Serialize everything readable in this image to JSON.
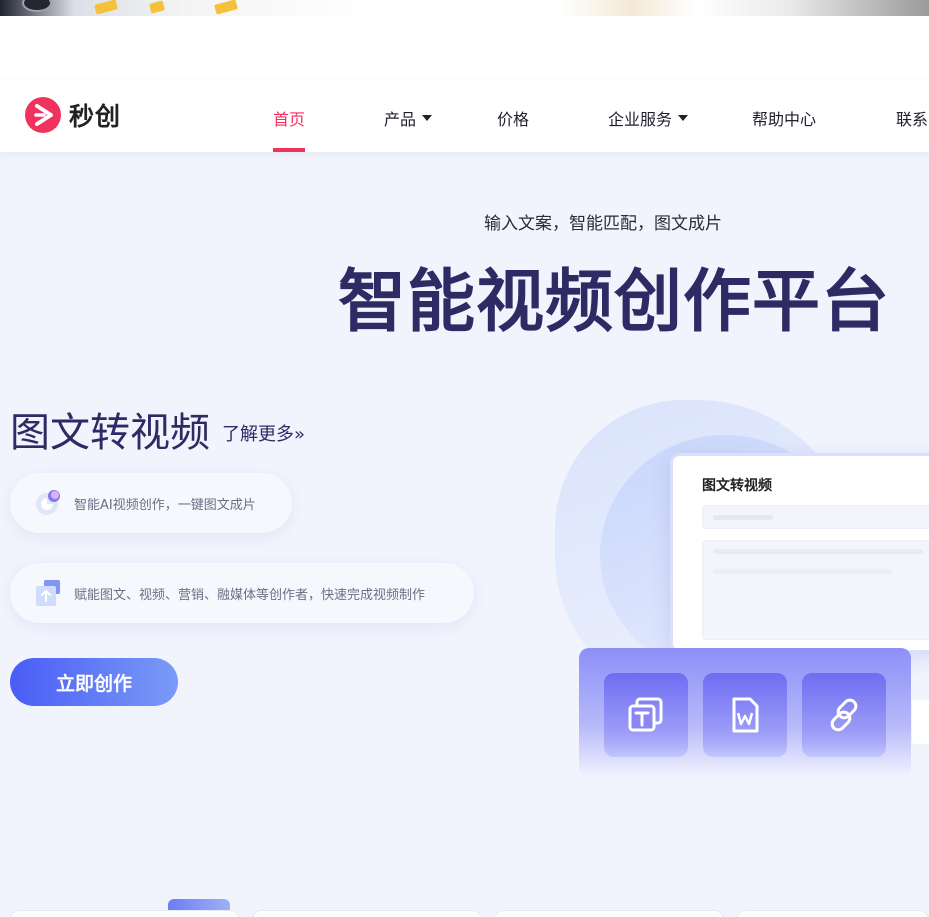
{
  "brand": {
    "name": "秒创",
    "accent": "#f0325f",
    "logo_icon": "play-chevron-icon"
  },
  "nav": {
    "items": [
      {
        "label": "首页",
        "active": true
      },
      {
        "label": "产品",
        "dropdown": true
      },
      {
        "label": "价格"
      },
      {
        "label": "企业服务",
        "dropdown": true
      },
      {
        "label": "帮助中心"
      },
      {
        "label": "联系"
      }
    ]
  },
  "hero": {
    "subtitle": "输入文案，智能匹配，图文成片",
    "title": "智能视频创作平台",
    "title_color": "#2d2a64"
  },
  "feature": {
    "title": "图文转视频",
    "learn_more": "了解更多»",
    "points": [
      {
        "icon": "ai-circle-icon",
        "text": "智能AI视频创作，一键图文成片"
      },
      {
        "icon": "upload-arrow-icon",
        "text": "赋能图文、视频、营销、融媒体等创作者，快速完成视频制作"
      }
    ],
    "cta": "立即创作"
  },
  "illustration": {
    "card_title": "图文转视频",
    "tiles": [
      {
        "icon": "text-box-icon"
      },
      {
        "icon": "word-doc-icon"
      },
      {
        "icon": "link-icon"
      }
    ]
  }
}
